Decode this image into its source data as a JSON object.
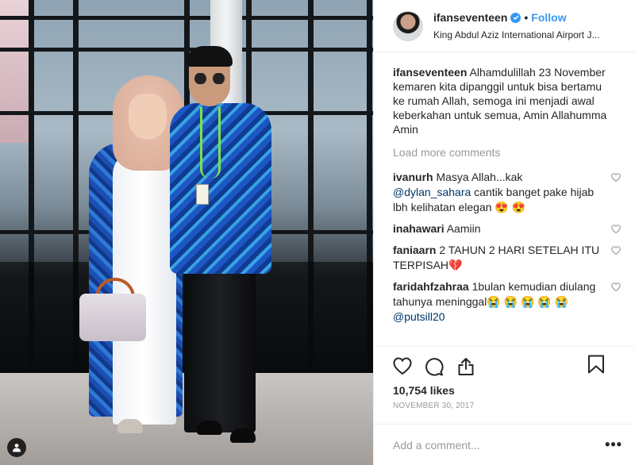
{
  "post": {
    "username": "ifanseventeen",
    "follow_label": "Follow",
    "separator": "•",
    "location": "King Abdul Aziz International Airport J...",
    "caption_username": "ifanseventeen",
    "caption_text": "Alhamdulillah 23 November kemaren kita dipanggil untuk bisa bertamu ke rumah Allah, semoga ini menjadi awal keberkahan untuk semua, Amin Allahumma Amin",
    "load_more": "Load more comments",
    "comments": [
      {
        "user": "ivanurh",
        "pre": "Masya Allah...kak",
        "mention": "@dylan_sahara",
        "post": "cantik banget pake hijab lbh kelihatan elegan 😍 😍"
      },
      {
        "user": "inahawari",
        "pre": "Aamiin",
        "mention": "",
        "post": ""
      },
      {
        "user": "faniaarn",
        "pre": "2 TAHUN 2 HARI SETELAH ITU TERPISAH💔",
        "mention": "",
        "post": ""
      },
      {
        "user": "faridahfzahraa",
        "pre": "1bulan kemudian diulang tahunya meninggal😭 😭 😭 😭 😭",
        "mention": "@putsill20",
        "post": ""
      }
    ],
    "likes": "10,754 likes",
    "date": "NOVEMBER 30, 2017",
    "add_comment_placeholder": "Add a comment...",
    "more_label": "•••"
  },
  "colors": {
    "accent": "#3897f0",
    "muted": "#999999",
    "text": "#262626",
    "border": "#efefef",
    "mention": "#003569"
  },
  "icons": [
    "verified-badge-icon",
    "heart-icon",
    "comment-icon",
    "share-icon",
    "bookmark-icon",
    "user-tag-icon",
    "more-options-icon"
  ]
}
